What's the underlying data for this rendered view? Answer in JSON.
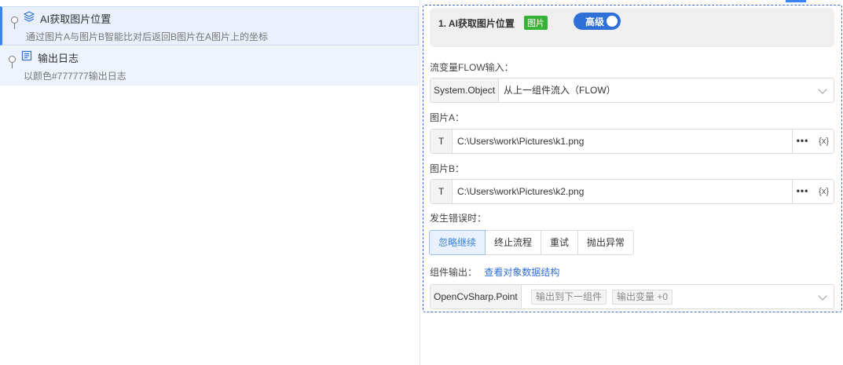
{
  "steps": [
    {
      "title": "AI获取图片位置",
      "desc": "通过图片A与图片B智能比对后返回B图片在A图片上的坐标",
      "icon": "layers-icon"
    },
    {
      "title": "输出日志",
      "desc": "以颜色#777777输出日志",
      "icon": "log-icon"
    }
  ],
  "panel": {
    "header": {
      "name": "1. AI获取图片位置",
      "tag": "图片",
      "toggle_label": "高级"
    },
    "flow_input": {
      "label": "流变量FLOW输入：",
      "type": "System.Object",
      "value": "从上一组件流入（FLOW）"
    },
    "image_a": {
      "label": "图片A：",
      "type_btn": "T",
      "value": "C:\\Users\\work\\Pictures\\k1.png",
      "more": "•••",
      "var": "{x}"
    },
    "image_b": {
      "label": "图片B：",
      "type_btn": "T",
      "value": "C:\\Users\\work\\Pictures\\k2.png",
      "more": "•••",
      "var": "{x}"
    },
    "on_error": {
      "label": "发生错误时：",
      "options": [
        "忽略继续",
        "终止流程",
        "重试",
        "抛出异常"
      ],
      "selected": "忽略继续"
    },
    "output": {
      "label": "组件输出：",
      "link": "查看对象数据结构",
      "type": "OpenCvSharp.Point",
      "chips": [
        "输出到下一组件",
        "输出变量 +0"
      ]
    }
  },
  "colors": {
    "accent": "#2f6fd8",
    "tag_green": "#36b336",
    "selected_bg": "#e9f0fb"
  }
}
